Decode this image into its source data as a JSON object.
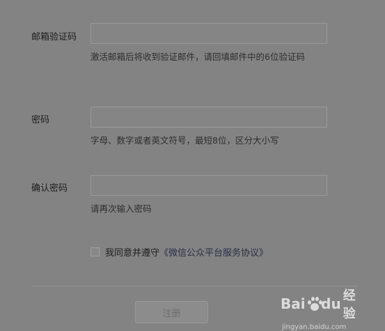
{
  "form": {
    "email_code": {
      "label": "邮箱验证码",
      "hint": "激活邮箱后将收到验证邮件，请回填邮件中的6位验证码"
    },
    "password": {
      "label": "密码",
      "hint": "字母、数字或者英文符号，最短8位，区分大小写"
    },
    "confirm_password": {
      "label": "确认密码",
      "hint": "请再次输入密码"
    },
    "agreement": {
      "prefix": "我同意并遵守",
      "link": "《微信公众平台服务协议》",
      "checked": false
    },
    "submit_label": "注册"
  },
  "watermark": {
    "brand_a": "Bai",
    "brand_b": "du",
    "brand_c": "经验",
    "site": "jingyan.baidu.com"
  }
}
